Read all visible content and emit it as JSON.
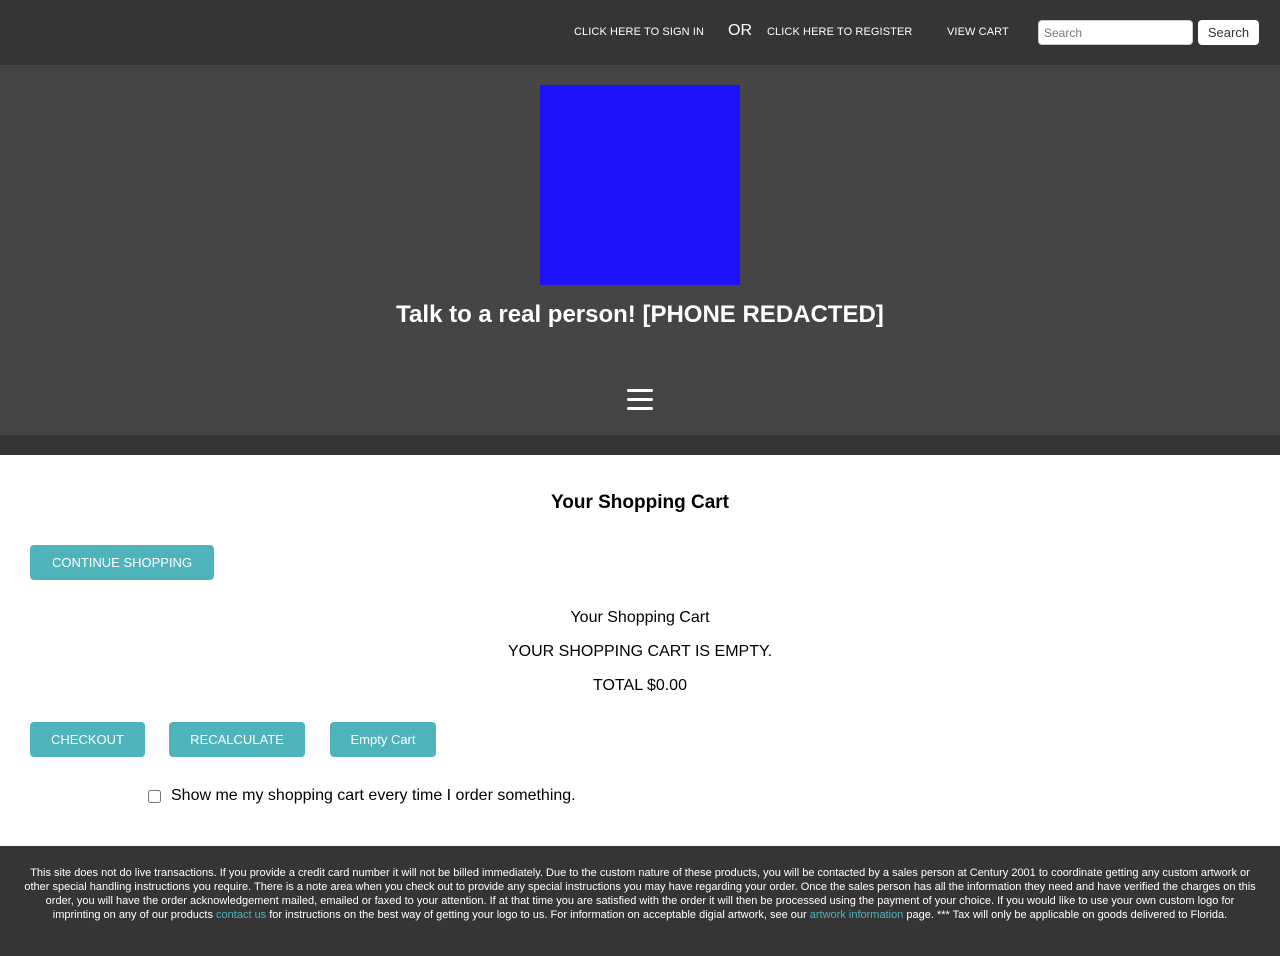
{
  "topbar": {
    "sign_in": "CLICK HERE TO SIGN IN",
    "or": "OR",
    "register": "CLICK HERE TO REGISTER",
    "view_cart": "VIEW CART",
    "search_placeholder": "Search",
    "search_button": "Search"
  },
  "header": {
    "phone_text": "Talk to a real person! [PHONE REDACTED]",
    "menu_icon": "hamburger-menu-icon",
    "logo_color": "#1f12fb"
  },
  "main": {
    "title": "Your Shopping Cart",
    "continue_button": "CONTINUE SHOPPING",
    "cart_label": "Your Shopping Cart",
    "empty_message": "YOUR SHOPPING CART IS EMPTY.",
    "total": "TOTAL $0.00",
    "checkout_button": "CHECKOUT",
    "recalculate_button": "RECALCULATE",
    "empty_cart_button": "Empty Cart",
    "show_cart_label": "Show me my shopping cart every time I order something.",
    "accent_color": "#4fb3bc"
  },
  "footer": {
    "text_1": "This site does not do live transactions. If you provide a credit card number it will not be billed immediately. Due to the custom nature of these products, you will be contacted by a sales person at Century 2001 to coordinate getting any custom artwork or other special handling instructions you require. There is a note area when you check out to provide any special instructions you may have regarding your order. Once the sales person has all the information they need and have verified the charges on this order, you will have the order acknowledgement mailed, emailed or faxed to your attention. If at that time you are satisfied with the order it will then be processed using the payment of your choice. If you would like to use your own custom logo for imprinting on any of our products ",
    "contact_link": "contact us",
    "text_2": " for instructions on the best way of getting your logo to us. For information on acceptable digial artwork, see our ",
    "artwork_link": "artwork information",
    "text_3": " page. *** Tax will only be applicable on goods delivered to Florida."
  }
}
